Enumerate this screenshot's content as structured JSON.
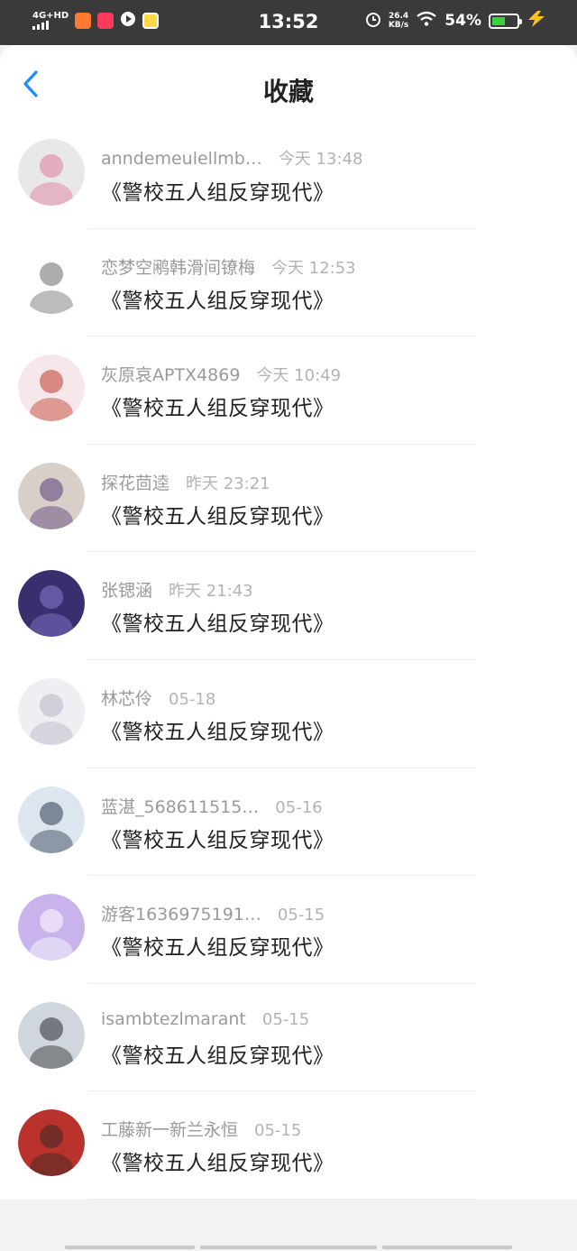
{
  "status_bar": {
    "network": "4G+HD",
    "time": "13:52",
    "speed_value": "26.4",
    "speed_unit": "KB/s",
    "battery_percent": "54%",
    "battery_level": 0.54,
    "icons": [
      "signal-icon",
      "app-icon-orange",
      "app-icon-red",
      "app-icon-play",
      "app-icon-yellow",
      "alarm-icon",
      "wifi-icon",
      "battery-icon",
      "charging-icon"
    ]
  },
  "header": {
    "title": "收藏",
    "back_icon": "chevron-left-icon"
  },
  "favorites": [
    {
      "username": "anndemeulellmb…",
      "time": "今天 13:48",
      "title": "《警校五人组反穿现代》",
      "avatar_color": "#e8e8e8",
      "avatar_accent": "#e07a9c"
    },
    {
      "username": "恋梦空鹇韩滑间镣梅",
      "time": "今天 12:53",
      "title": "《警校五人组反穿现代》",
      "avatar_color": "#ffffff",
      "avatar_accent": "#6a6a6a"
    },
    {
      "username": "灰原哀APTX4869",
      "time": "今天 10:49",
      "title": "《警校五人组反穿现代》",
      "avatar_color": "#f6e7ea",
      "avatar_accent": "#c0392b"
    },
    {
      "username": "探花茴逵",
      "time": "昨天 23:21",
      "title": "《警校五人组反穿现代》",
      "avatar_color": "#d8cfc8",
      "avatar_accent": "#5a3c7a"
    },
    {
      "username": "张锶涵",
      "time": "昨天 21:43",
      "title": "《警校五人组反穿现代》",
      "avatar_color": "#3b2e6e",
      "avatar_accent": "#8a7ad0"
    },
    {
      "username": "林芯伶",
      "time": "05-18",
      "title": "《警校五人组反穿现代》",
      "avatar_color": "#f0eef2",
      "avatar_accent": "#b9b4c7"
    },
    {
      "username": "蓝湛_568611515…",
      "time": "05-16",
      "title": "《警校五人组反穿现代》",
      "avatar_color": "#dde6ef",
      "avatar_accent": "#2c3a50"
    },
    {
      "username": "游客1636975191…",
      "time": "05-15",
      "title": "《警校五人组反穿现代》",
      "avatar_color": "#c9b3ec",
      "avatar_accent": "#ffffff"
    },
    {
      "username": "isambtezlmarant",
      "time": "05-15",
      "title": "《警校五人组反穿现代》",
      "avatar_color": "#cfd6dd",
      "avatar_accent": "#2b2b2b"
    },
    {
      "username": "工藤新一新兰永恒",
      "time": "05-15",
      "title": "《警校五人组反穿现代》",
      "avatar_color": "#b9322b",
      "avatar_accent": "#3a2a24"
    }
  ],
  "colors": {
    "accent": "#1a8cff",
    "status_bar_bg": "#3a3a3a",
    "page_bg": "#f2f2f4"
  }
}
